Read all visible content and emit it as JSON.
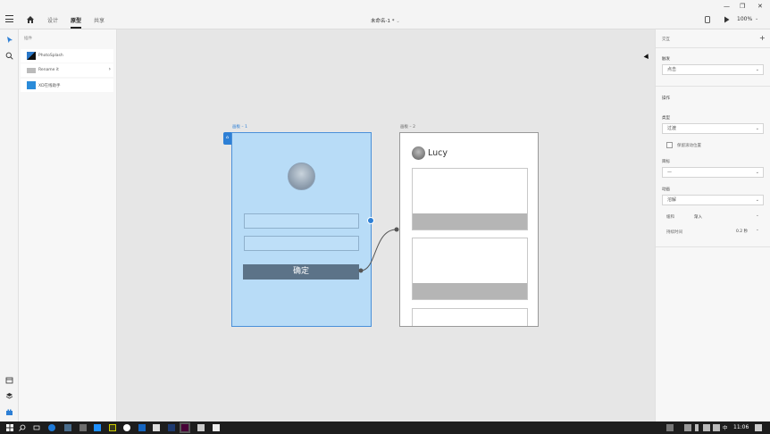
{
  "topbar": {
    "tabs": [
      "设计",
      "原型",
      "共享"
    ],
    "active_tab": "原型",
    "doc_title": "未命名-1 *",
    "zoom": "100%"
  },
  "assets": {
    "title": "插件",
    "items": [
      {
        "label": "PhotoSplash",
        "icon": "photosplash-icon"
      },
      {
        "label": "Rename it",
        "icon": "rename-it-icon",
        "has_arrow": true
      },
      {
        "label": "XD在线助手",
        "icon": "xd-helper-icon"
      }
    ]
  },
  "canvas": {
    "artboard1": {
      "label": "画板 – 1",
      "button_label": "确定"
    },
    "artboard2": {
      "label": "画板 – 2",
      "user_name": "Lucy"
    }
  },
  "right_panel": {
    "title": "交互",
    "trigger_label": "触发",
    "trigger_value": "点击",
    "action_header": "操作",
    "type_label": "类型",
    "type_value": "过渡",
    "preserve_scroll": "保留滚动位置",
    "target_label": "目标",
    "target_value": "—",
    "animation_label": "动画",
    "animation_value": "溶解",
    "easing_label": "缓和",
    "easing_value": "渐入",
    "duration_label": "持续时间",
    "duration_value": "0.2 秒"
  },
  "taskbar": {
    "clock": "11:06",
    "lang": "中"
  },
  "colors": {
    "selection_blue": "#2d7fd5",
    "artboard1_fill": "#b8dcf7",
    "button_fill": "#5c7388",
    "placeholder_gray": "#b5b5b5"
  }
}
